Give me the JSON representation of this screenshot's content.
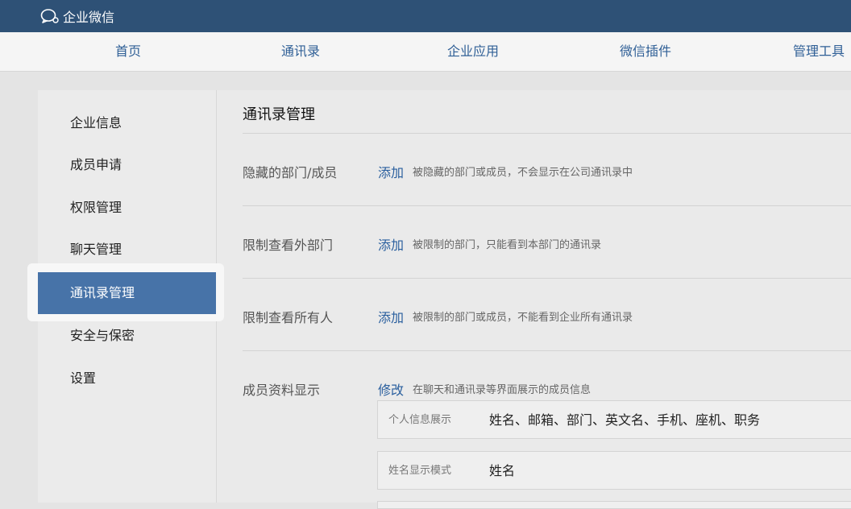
{
  "app": {
    "brand": "企业微信",
    "logo_icon": "chat-bubble-icon"
  },
  "nav": {
    "items": [
      {
        "label": "首页"
      },
      {
        "label": "通讯录"
      },
      {
        "label": "企业应用"
      },
      {
        "label": "微信插件"
      },
      {
        "label": "管理工具"
      }
    ]
  },
  "sidebar": {
    "items": [
      {
        "label": "企业信息"
      },
      {
        "label": "成员申请"
      },
      {
        "label": "权限管理"
      },
      {
        "label": "聊天管理"
      },
      {
        "label": "通讯录管理",
        "active": true
      },
      {
        "label": "安全与保密"
      },
      {
        "label": "设置"
      }
    ]
  },
  "main": {
    "title": "通讯录管理",
    "rows": [
      {
        "label": "隐藏的部门/成员",
        "action": "添加",
        "desc": "被隐藏的部门或成员，不会显示在公司通讯录中"
      },
      {
        "label": "限制查看外部门",
        "action": "添加",
        "desc": "被限制的部门，只能看到本部门的通讯录"
      },
      {
        "label": "限制查看所有人",
        "action": "添加",
        "desc": "被限制的部门或成员，不能看到企业所有通讯录"
      },
      {
        "label": "成员资料显示",
        "action": "修改",
        "desc": "在聊天和通讯录等界面展示的成员信息"
      }
    ],
    "info": [
      {
        "key": "个人信息展示",
        "value": "姓名、邮箱、部门、英文名、手机、座机、职务"
      },
      {
        "key": "姓名显示模式",
        "value": "姓名"
      }
    ]
  },
  "colors": {
    "titlebar": "#2e5176",
    "link": "#2a5f9e",
    "active_item": "#4773a8"
  }
}
